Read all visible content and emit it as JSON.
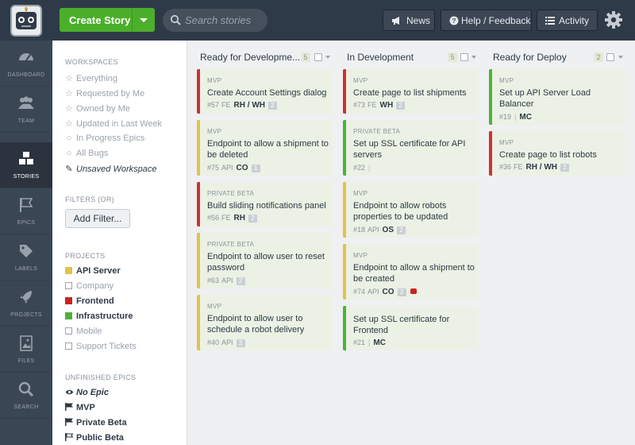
{
  "topbar": {
    "create_label": "Create Story",
    "search_placeholder": "Search stories",
    "news_label": "News",
    "help_label": "Help / Feedback",
    "activity_label": "Activity"
  },
  "rail": {
    "dashboard": "DASHBOARD",
    "team": "TEAM",
    "stories": "STORIES",
    "epics": "EPICS",
    "labels": "LABELS",
    "projects": "PROJECTS",
    "files": "FILES",
    "search": "SEARCH"
  },
  "sidebar": {
    "workspaces_title": "WORKSPACES",
    "workspaces": [
      {
        "label": "Everything",
        "mark": "☆"
      },
      {
        "label": "Requested by Me",
        "mark": "☆"
      },
      {
        "label": "Owned by Me",
        "mark": "☆"
      },
      {
        "label": "Updated in Last Week",
        "mark": "☆"
      },
      {
        "label": "In Progress Epics",
        "mark": "○"
      },
      {
        "label": "All Bugs",
        "mark": "○"
      },
      {
        "label": "Unsaved Workspace",
        "mark": "✎"
      }
    ],
    "filters_title": "FILTERS (OR)",
    "add_filter": "Add Filter...",
    "projects_title": "PROJECTS",
    "projects": [
      {
        "label": "API Server",
        "color": "#e2c24a",
        "checked": true
      },
      {
        "label": "Company",
        "color": "#9aa3ad",
        "checked": false
      },
      {
        "label": "Frontend",
        "color": "#cc2222",
        "checked": true
      },
      {
        "label": "Infrastructure",
        "color": "#4db23a",
        "checked": true
      },
      {
        "label": "Mobile",
        "color": "#9aa3ad",
        "checked": false
      },
      {
        "label": "Support Tickets",
        "color": "#9aa3ad",
        "checked": false
      }
    ],
    "epics_title": "UNFINISHED EPICS",
    "epics": [
      {
        "label": "No Epic"
      },
      {
        "label": "MVP"
      },
      {
        "label": "Private Beta"
      },
      {
        "label": "Public Beta"
      }
    ]
  },
  "board": {
    "columns": [
      {
        "title": "Ready for Developme...",
        "count": "5",
        "cards": [
          {
            "epic": "MVP",
            "title": "Create Account Settings dialog",
            "id": "#57",
            "type": "FE",
            "owner": "RH / WH",
            "estimate": "2",
            "color": "red"
          },
          {
            "epic": "MVP",
            "title": "Endpoint to allow a shipment to be deleted",
            "id": "#75",
            "type": "API",
            "owner": "CO",
            "estimate": "1",
            "color": "yellow"
          },
          {
            "epic": "PRIVATE BETA",
            "title": "Build sliding notifications panel",
            "id": "#56",
            "type": "FE",
            "owner": "RH",
            "estimate": "2",
            "color": "red"
          },
          {
            "epic": "PRIVATE BETA",
            "title": "Endpoint to allow user to reset password",
            "id": "#63",
            "type": "API",
            "owner": "",
            "estimate": "2",
            "color": "yellow"
          },
          {
            "epic": "MVP",
            "title": "Endpoint to allow user to schedule a robot delivery",
            "id": "#40",
            "type": "API",
            "owner": "",
            "estimate": "2",
            "color": "yellow"
          }
        ]
      },
      {
        "title": "In Development",
        "count": "5",
        "cards": [
          {
            "epic": "MVP",
            "title": "Create page to list shipments",
            "id": "#73",
            "type": "FE",
            "owner": "WH",
            "estimate": "2",
            "color": "red"
          },
          {
            "epic": "PRIVATE BETA",
            "title": "Set up SSL certificate for API servers",
            "id": "#22",
            "type": "",
            "owner": "",
            "estimate": "",
            "color": "green"
          },
          {
            "epic": "MVP",
            "title": "Endpoint to allow robots properties to be updated",
            "id": "#18",
            "type": "API",
            "owner": "OS",
            "estimate": "2",
            "color": "yellow"
          },
          {
            "epic": "MVP",
            "title": "Endpoint to allow a shipment to be created",
            "id": "#74",
            "type": "API",
            "owner": "CO",
            "estimate": "2",
            "color": "yellow",
            "flag": true
          },
          {
            "epic": "",
            "title": "Set up SSL certificate for Frontend",
            "id": "#21",
            "type": "",
            "owner": "MC",
            "estimate": "",
            "color": "green"
          }
        ]
      },
      {
        "title": "Ready for Deploy",
        "count": "2",
        "cards": [
          {
            "epic": "MVP",
            "title": "Set up API Server Load Balancer",
            "id": "#19",
            "type": "",
            "owner": "MC",
            "estimate": "",
            "color": "green"
          },
          {
            "epic": "MVP",
            "title": "Create page to list robots",
            "id": "#36",
            "type": "FE",
            "owner": "RH / WH",
            "estimate": "2",
            "color": "red"
          }
        ]
      }
    ]
  }
}
